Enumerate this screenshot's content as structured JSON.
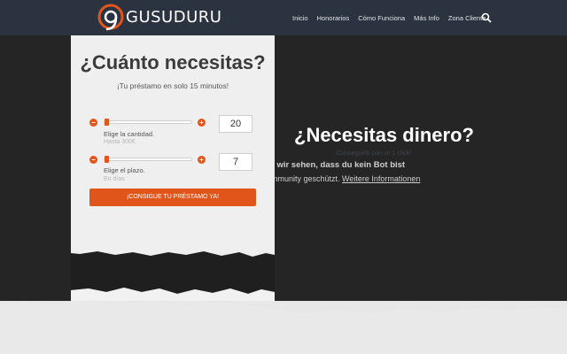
{
  "header": {
    "brand": "GUSUDURU",
    "nav": [
      "Inicio",
      "Honorarios",
      "Cómo Funciona",
      "Más Info",
      "Zona Cliente"
    ]
  },
  "card": {
    "title": "¿Cuánto necesitas?",
    "subtitle": "¡Tu préstamo en solo 15 minutos!",
    "amount": {
      "value": "20",
      "label": "Elige la cantidad.",
      "hint": "Hasta 300€",
      "fraction": 0.0
    },
    "term": {
      "value": "7",
      "label": "Elige el plazo.",
      "hint": "En días",
      "fraction": 0.0
    },
    "cta": "¡CONSIGUE TU PRÉSTAMO YA!"
  },
  "hero": {
    "title": "¿Necesitas dinero?",
    "subtitle": "¡Conseguirlo con un 1 click!",
    "gdpr_line1": "it wir sehen, dass du kein Bot bist",
    "gdpr_line2_prefix": "mmunity geschützt.",
    "gdpr_more": "Weitere Informationen"
  },
  "colors": {
    "accent": "#e2551a",
    "header_bg": "#2b3340",
    "hero_bg": "#252525"
  }
}
